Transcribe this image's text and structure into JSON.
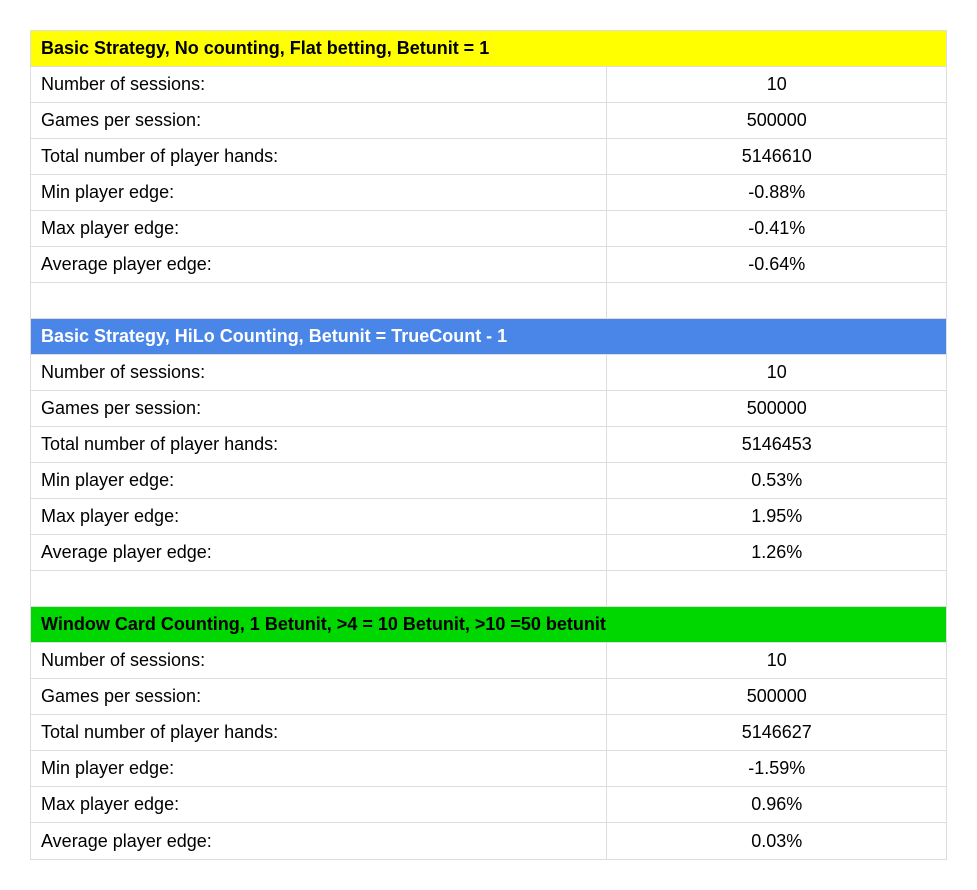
{
  "sections": [
    {
      "headerClass": "hdr-yellow",
      "header": "Basic Strategy, No counting, Flat betting, Betunit = 1",
      "rows": [
        {
          "label": "Number of sessions:",
          "value": "10"
        },
        {
          "label": "Games per session:",
          "value": "500000"
        },
        {
          "label": "Total number of player hands:",
          "value": "5146610"
        },
        {
          "label": "Min player edge:",
          "value": "-0.88%"
        },
        {
          "label": "Max player edge:",
          "value": "-0.41%"
        },
        {
          "label": "Average player edge:",
          "value": "-0.64%"
        }
      ]
    },
    {
      "headerClass": "hdr-blue",
      "header": "Basic Strategy, HiLo Counting, Betunit = TrueCount - 1",
      "rows": [
        {
          "label": "Number of sessions:",
          "value": "10"
        },
        {
          "label": "Games per session:",
          "value": "500000"
        },
        {
          "label": "Total number of player hands:",
          "value": "5146453"
        },
        {
          "label": "Min player edge:",
          "value": "0.53%"
        },
        {
          "label": "Max player edge:",
          "value": "1.95%"
        },
        {
          "label": "Average player edge:",
          "value": "1.26%"
        }
      ]
    },
    {
      "headerClass": "hdr-green",
      "header": "Window Card Counting, 1 Betunit, >4 = 10 Betunit, >10 =50 betunit",
      "rows": [
        {
          "label": "Number of sessions:",
          "value": "10"
        },
        {
          "label": "Games per session:",
          "value": "500000"
        },
        {
          "label": "Total number of player hands:",
          "value": "5146627"
        },
        {
          "label": "Min player edge:",
          "value": "-1.59%"
        },
        {
          "label": "Max player edge:",
          "value": "0.96%"
        },
        {
          "label": "Average player edge:",
          "value": "0.03%"
        }
      ]
    }
  ]
}
